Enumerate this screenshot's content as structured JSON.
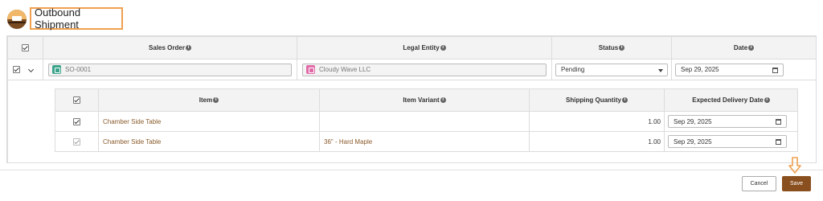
{
  "header": {
    "title": "Outbound Shipment",
    "logo_icon": "delivery-truck-logo"
  },
  "orders_table": {
    "columns": {
      "sales_order": "Sales Order",
      "legal_entity": "Legal Entity",
      "status": "Status",
      "date": "Date"
    },
    "row": {
      "sales_order": "SO-0001",
      "legal_entity": "Cloudy Wave LLC",
      "status": "Pending",
      "date": "Sep 29, 2025"
    }
  },
  "items_table": {
    "columns": {
      "item": "Item",
      "item_variant": "Item Variant",
      "shipping_quantity": "Shipping Quantity",
      "expected_delivery_date": "Expected Delivery Date"
    },
    "rows": [
      {
        "item": "Chamber Side Table",
        "item_variant": "",
        "shipping_quantity": "1.00",
        "expected_delivery_date": "Sep 29, 2025"
      },
      {
        "item": "Chamber Side Table",
        "item_variant": "36\" - Hard Maple",
        "shipping_quantity": "1.00",
        "expected_delivery_date": "Sep 29, 2025"
      }
    ]
  },
  "footer": {
    "cancel_label": "Cancel",
    "save_label": "Save"
  },
  "colors": {
    "accent": "#8a4f1f",
    "highlight": "#f0a050",
    "link": "#8a5a2b"
  }
}
